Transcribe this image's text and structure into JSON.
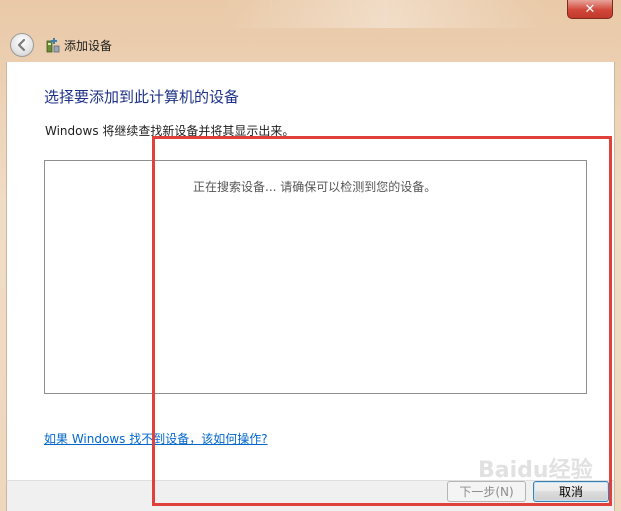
{
  "window": {
    "title": "添加设备",
    "close_glyph": "✕"
  },
  "content": {
    "heading": "选择要添加到此计算机的设备",
    "subtext": "Windows 将继续查找新设备并将其显示出来。",
    "searching_text": "正在搜索设备... 请确保可以检测到您的设备。",
    "help_link": "如果 Windows 找不到设备，该如何操作?"
  },
  "buttons": {
    "next_label": "下一步(N)",
    "cancel_label": "取消"
  },
  "watermark": "Baidu经验",
  "colors": {
    "heading": "#1e3287",
    "link": "#0066cc",
    "highlight": "#e0413a"
  }
}
